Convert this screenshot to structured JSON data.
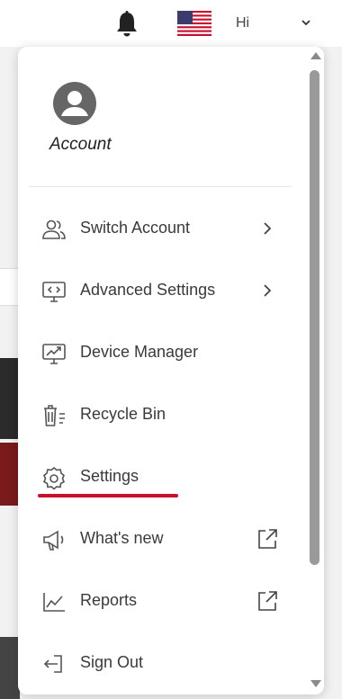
{
  "header": {
    "notification_icon": "bell-icon",
    "flag_icon": "us-flag-icon",
    "greeting": "Hi",
    "caret_icon": "chevron-down-icon"
  },
  "account": {
    "avatar_icon": "user-avatar-icon",
    "label": "Account"
  },
  "menu": {
    "items": [
      {
        "label": "Switch Account",
        "icon": "users-icon",
        "trail": "chevron-right-icon"
      },
      {
        "label": "Advanced Settings",
        "icon": "monitor-code-icon",
        "trail": "chevron-right-icon"
      },
      {
        "label": "Device Manager",
        "icon": "monitor-chart-icon",
        "trail": ""
      },
      {
        "label": "Recycle Bin",
        "icon": "trash-icon",
        "trail": ""
      },
      {
        "label": "Settings",
        "icon": "gear-icon",
        "trail": ""
      },
      {
        "label": "What's new",
        "icon": "megaphone-icon",
        "trail": "external-link-icon"
      },
      {
        "label": "Reports",
        "icon": "line-chart-icon",
        "trail": "external-link-icon"
      },
      {
        "label": "Sign Out",
        "icon": "sign-out-icon",
        "trail": ""
      }
    ]
  },
  "colors": {
    "highlight_underline": "#c8102e",
    "text": "#3a3a3a",
    "icon": "#555555"
  }
}
